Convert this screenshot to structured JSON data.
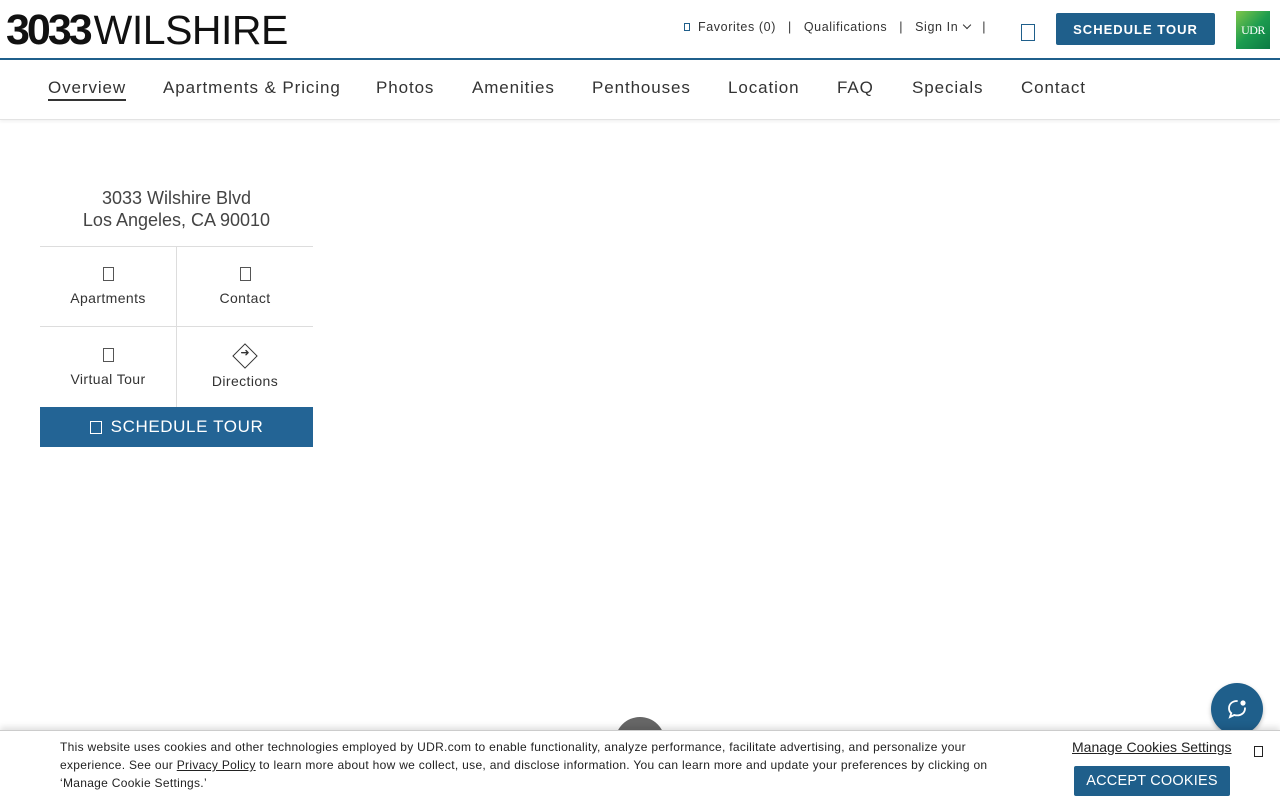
{
  "brand": {
    "logo_number": "3033",
    "logo_word": "WILSHIRE",
    "udr_logo": "UDR"
  },
  "utility": {
    "favorites": "Favorites (0)",
    "separator": "|",
    "qualifications": "Qualifications",
    "sign_in": "Sign In",
    "schedule_tour": "SCHEDULE TOUR"
  },
  "nav": {
    "items": [
      {
        "label": "Overview",
        "active": true
      },
      {
        "label": "Apartments & Pricing"
      },
      {
        "label": "Photos"
      },
      {
        "label": "Amenities"
      },
      {
        "label": "Penthouses"
      },
      {
        "label": "Location"
      },
      {
        "label": "FAQ"
      },
      {
        "label": "Specials"
      },
      {
        "label": "Contact"
      }
    ]
  },
  "info": {
    "address_line1": "3033 Wilshire Blvd",
    "address_line2": "Los Angeles, CA 90010",
    "apartments": "Apartments",
    "contact": "Contact",
    "virtual_tour": "Virtual Tour",
    "directions": "Directions",
    "schedule_tour": "SCHEDULE TOUR"
  },
  "cookie": {
    "text_before_link": "This website uses cookies and other technologies employed by UDR.com to enable functionality, analyze performance, facilitate advertising, and personalize your experience. See our ",
    "privacy_link": "Privacy Policy",
    "text_after_link": " to learn more about how we collect, use, and disclose information. You can learn more and update your preferences by clicking on ‘Manage Cookie Settings.’",
    "manage": "Manage Cookies Settings",
    "accept": "ACCEPT COOKIES"
  },
  "colors": {
    "accent": "#1f5f8b",
    "button_blue": "#236495"
  }
}
